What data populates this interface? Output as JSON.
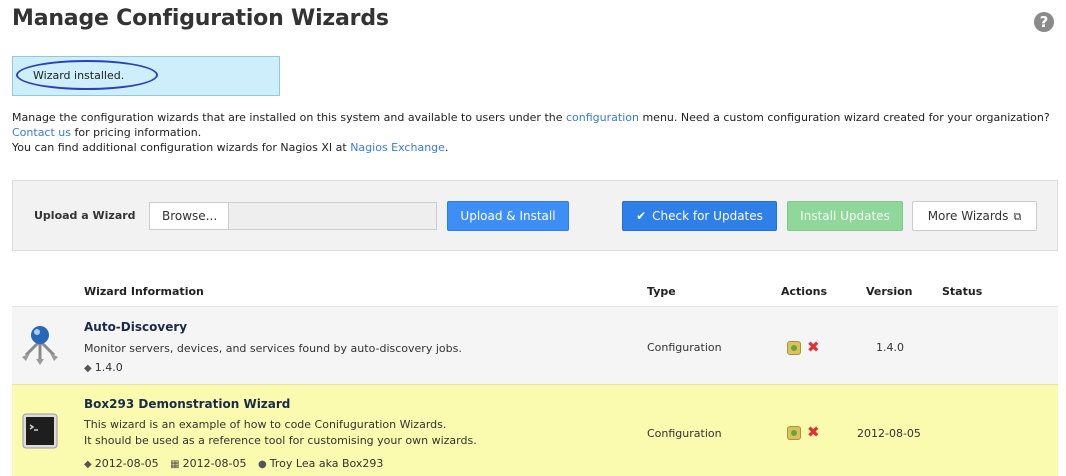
{
  "page": {
    "title": "Manage Configuration Wizards",
    "help_icon": "?"
  },
  "alert": {
    "message": "Wizard installed."
  },
  "intro": {
    "line1_pre": "Manage the configuration wizards that are installed on this system and available to users under the ",
    "line1_link": "configuration",
    "line1_post": " menu. Need a custom configuration wizard created for your organization? ",
    "contact_link": "Contact us",
    "line2_post": " for pricing information.",
    "line3_pre": "You can find additional configuration wizards for Nagios XI at ",
    "exchange_link": "Nagios Exchange",
    "line3_post": "."
  },
  "upload": {
    "label": "Upload a Wizard",
    "browse_label": "Browse...",
    "upload_install_label": "Upload & Install",
    "check_updates_label": "Check for Updates",
    "install_updates_label": "Install Updates",
    "more_wizards_label": "More Wizards"
  },
  "table": {
    "headers": {
      "info": "Wizard Information",
      "type": "Type",
      "actions": "Actions",
      "version": "Version",
      "status": "Status"
    },
    "rows": [
      {
        "name": "Auto-Discovery",
        "description": "Monitor servers, devices, and services found by auto-discovery jobs.",
        "tag_version": "1.4.0",
        "type": "Configuration",
        "version": "1.4.0",
        "status": "",
        "icon": "auto-discovery-icon"
      },
      {
        "name": "Box293 Demonstration Wizard",
        "description_line1": "This wizard is an example of how to code Conifuguration Wizards.",
        "description_line2": "It should be used as a reference tool for customising your own wizards.",
        "tag_version": "2012-08-05",
        "date": "2012-08-05",
        "author": "Troy Lea aka Box293",
        "type": "Configuration",
        "version": "2012-08-05",
        "status": "",
        "icon": "terminal-icon"
      }
    ]
  },
  "colors": {
    "primary_button": "#3e8ef7",
    "install_updates_button": "#8fd79a",
    "highlight_row": "#fbfbb0",
    "alert_bg": "#cdeefa",
    "delete_red": "#e53030"
  }
}
